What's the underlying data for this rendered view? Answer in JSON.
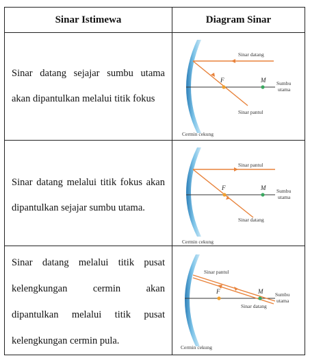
{
  "header": {
    "col1": "Sinar Istimewa",
    "col2": "Diagram Sinar"
  },
  "rows": [
    {
      "text": "Sinar datang sejajar sumbu utama akan dipantulkan melalui titik fokus",
      "diagram": {
        "incoming_label": "Sinar datang",
        "reflected_label": "Sinar pantul",
        "focus_label": "F",
        "center_label": "M",
        "axis_label_1": "Sumbu",
        "axis_label_2": "utama",
        "mirror_label": "Cermin cekung"
      }
    },
    {
      "text": "Sinar datang melalui titik fokus akan dipantulkan sejajar sumbu utama.",
      "diagram": {
        "incoming_label": "Sinar datang",
        "reflected_label": "Sinar pantul",
        "focus_label": "F",
        "center_label": "M",
        "axis_label_1": "Sumbu",
        "axis_label_2": "utama",
        "mirror_label": "Cermin cekung"
      }
    },
    {
      "text": "Sinar datang melalui titik pusat kelengkungan cermin akan dipantulkan melalui titik pusat kelengkungan cermin pula.",
      "diagram": {
        "incoming_label": "Sinar datang",
        "reflected_label": "Sinar pantul",
        "focus_label": "F",
        "center_label": "M",
        "axis_label_1": "Sumbu",
        "axis_label_2": "utama",
        "mirror_label": "Cermin cekung"
      }
    }
  ],
  "colors": {
    "ray": "#e8823a",
    "mirror": "#5aaed8",
    "focus_dot": "#f0a030",
    "center_dot": "#3aa860",
    "axis": "#333333"
  }
}
